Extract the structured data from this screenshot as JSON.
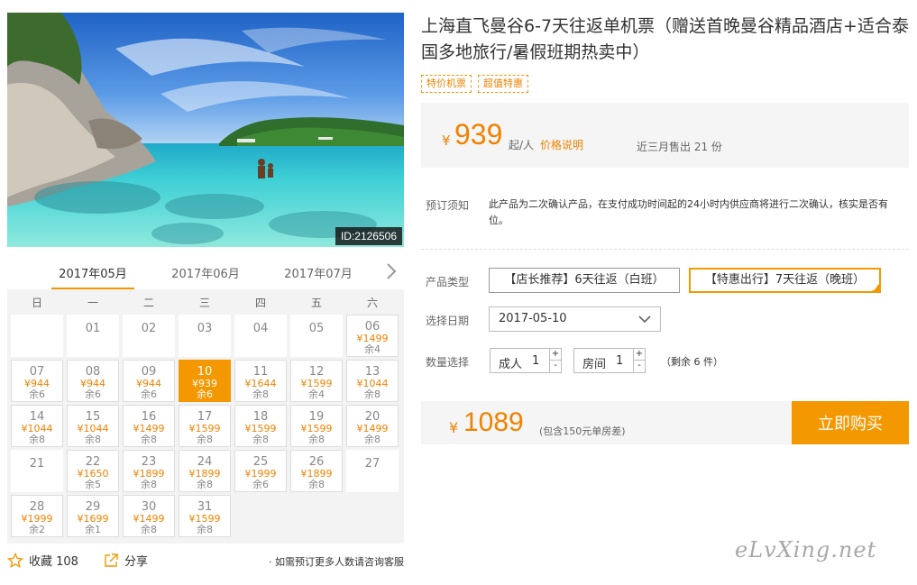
{
  "hero": {
    "image_id": "ID:2126506"
  },
  "calendar": {
    "months": [
      "2017年05月",
      "2017年06月",
      "2017年07月"
    ],
    "active_month": 0,
    "weekdays": [
      "日",
      "一",
      "二",
      "三",
      "四",
      "五",
      "六"
    ],
    "days": [
      {
        "day": "",
        "price": "",
        "stock": ""
      },
      {
        "day": "01",
        "price": "",
        "stock": ""
      },
      {
        "day": "02",
        "price": "",
        "stock": ""
      },
      {
        "day": "03",
        "price": "",
        "stock": ""
      },
      {
        "day": "04",
        "price": "",
        "stock": ""
      },
      {
        "day": "05",
        "price": "",
        "stock": ""
      },
      {
        "day": "06",
        "price": "¥1499",
        "stock": "余4"
      },
      {
        "day": "07",
        "price": "¥944",
        "stock": "余6"
      },
      {
        "day": "08",
        "price": "¥944",
        "stock": "余6"
      },
      {
        "day": "09",
        "price": "¥944",
        "stock": "余6"
      },
      {
        "day": "10",
        "price": "¥939",
        "stock": "余6",
        "selected": true
      },
      {
        "day": "11",
        "price": "¥1644",
        "stock": "余8"
      },
      {
        "day": "12",
        "price": "¥1599",
        "stock": "余4"
      },
      {
        "day": "13",
        "price": "¥1044",
        "stock": "余8"
      },
      {
        "day": "14",
        "price": "¥1044",
        "stock": "余8"
      },
      {
        "day": "15",
        "price": "¥1044",
        "stock": "余8"
      },
      {
        "day": "16",
        "price": "¥1499",
        "stock": "余8"
      },
      {
        "day": "17",
        "price": "¥1599",
        "stock": "余8"
      },
      {
        "day": "18",
        "price": "¥1599",
        "stock": "余8"
      },
      {
        "day": "19",
        "price": "¥1599",
        "stock": "余8"
      },
      {
        "day": "20",
        "price": "¥1499",
        "stock": "余8"
      },
      {
        "day": "21",
        "price": "",
        "stock": ""
      },
      {
        "day": "22",
        "price": "¥1650",
        "stock": "余5"
      },
      {
        "day": "23",
        "price": "¥1899",
        "stock": "余8"
      },
      {
        "day": "24",
        "price": "¥1899",
        "stock": "余8"
      },
      {
        "day": "25",
        "price": "¥1999",
        "stock": "余6"
      },
      {
        "day": "26",
        "price": "¥1899",
        "stock": "余8"
      },
      {
        "day": "27",
        "price": "",
        "stock": ""
      },
      {
        "day": "28",
        "price": "¥1999",
        "stock": "余2"
      },
      {
        "day": "29",
        "price": "¥1699",
        "stock": "余1"
      },
      {
        "day": "30",
        "price": "¥1499",
        "stock": "余8"
      },
      {
        "day": "31",
        "price": "¥1599",
        "stock": "余8"
      }
    ]
  },
  "footer": {
    "favorite_label": "收藏 108",
    "share_label": "分享",
    "note": "· 如需预订更多人数请咨询客服"
  },
  "product": {
    "title": "上海直飞曼谷6-7天往返单机票（赠送首晚曼谷精品酒店+适合泰国多地旅行/暑假班期热卖中）",
    "tags": [
      "特价机票",
      "超值特惠"
    ]
  },
  "price": {
    "currency": "¥",
    "amount": "939",
    "unit": "起/人",
    "link": "价格说明",
    "sold": "近三月售出 21 份"
  },
  "booking_note": {
    "label": "预订须知",
    "text": "此产品为二次确认产品，在支付成功时间起的24小时内供应商将进行二次确认，核实是否有位。"
  },
  "options": {
    "type_label": "产品类型",
    "types": [
      "【店长推荐】6天往返（白班）",
      "【特惠出行】7天往返（晚班）"
    ],
    "selected_type": 1,
    "date_label": "选择日期",
    "date_value": "2017-05-10",
    "qty_label": "数量选择",
    "adult_label": "成人",
    "adult_value": "1",
    "room_label": "房间",
    "room_value": "1",
    "remain": "（剩余 6 件）",
    "plus": "+",
    "minus": "-"
  },
  "total": {
    "currency": "¥",
    "amount": "1089",
    "note": "(包含150元单房差)",
    "buy_label": "立即购买"
  },
  "watermark": "eLvXing.net",
  "colors": {
    "accent": "#f39800",
    "price": "#f08200"
  }
}
